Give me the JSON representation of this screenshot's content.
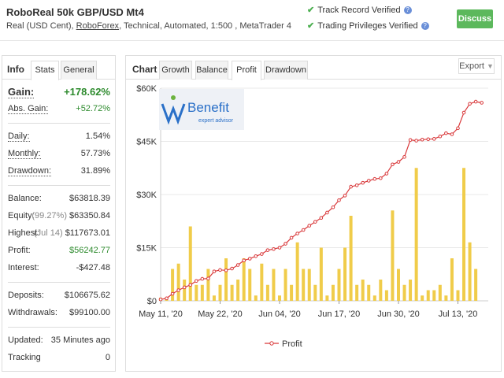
{
  "header": {
    "title": "RoboReal 50k GBP/USD Mt4",
    "subtitle_prefix": "Real (USD Cent), ",
    "broker": "RoboForex",
    "subtitle_suffix": ", Technical, Automated, 1:500 , MetaTrader 4",
    "verification": [
      {
        "label": "Track Record Verified"
      },
      {
        "label": "Trading Privileges Verified"
      }
    ],
    "discuss_label": "Discuss"
  },
  "left_panel": {
    "title": "Info",
    "tabs": [
      "Stats",
      "General"
    ],
    "active_tab": "Stats",
    "stats": [
      {
        "label": "Gain:",
        "value": "+178.62%",
        "group": 1,
        "style": "big-green"
      },
      {
        "label": "Abs. Gain:",
        "value": "+52.72%",
        "group": 1,
        "style": "green"
      },
      {
        "label": "Daily:",
        "value": "1.54%",
        "group": 2
      },
      {
        "label": "Monthly:",
        "value": "57.73%",
        "group": 2
      },
      {
        "label": "Drawdown:",
        "value": "31.89%",
        "group": 2
      },
      {
        "label": "Balance:",
        "value": "$63818.39",
        "group": 3
      },
      {
        "label": "Equity:",
        "prefix": "(99.27%)",
        "value": "$63350.84",
        "group": 3
      },
      {
        "label": "Highest:",
        "prefix": "(Jul 14)",
        "value": "$117673.01",
        "group": 3
      },
      {
        "label": "Profit:",
        "value": "$56242.77",
        "group": 3,
        "style": "green"
      },
      {
        "label": "Interest:",
        "value": "-$427.48",
        "group": 3
      },
      {
        "label": "Deposits:",
        "value": "$106675.62",
        "group": 4
      },
      {
        "label": "Withdrawals:",
        "value": "$99100.00",
        "group": 4
      },
      {
        "label": "Updated:",
        "value": "35 Minutes ago",
        "group": 5
      },
      {
        "label": "Tracking",
        "value": "0",
        "group": 5
      }
    ]
  },
  "right_panel": {
    "title": "Chart",
    "tabs": [
      "Growth",
      "Balance",
      "Profit",
      "Drawdown"
    ],
    "active_tab": "Profit",
    "export_label": "Export",
    "watermark": {
      "brand": "Benefit",
      "tagline": "expert advisor"
    }
  },
  "colors": {
    "line": "#d9393b",
    "bars": "#f0cc4a",
    "green": "#2e8b2e",
    "discuss": "#5cb85c"
  },
  "chart_data": {
    "type": "line",
    "legend": "Profit",
    "legend_position": "bottom",
    "y_ticks": [
      "$0",
      "$15K",
      "$30K",
      "$45K",
      "$60K"
    ],
    "ylim": [
      0,
      60000
    ],
    "x_ticks": [
      "May 11, '20",
      "May 22, '20",
      "Jun 04, '20",
      "Jun 17, '20",
      "Jun 30, '20",
      "Jul 13, '20"
    ],
    "x_tick_index": [
      0,
      10,
      20,
      30,
      40,
      50
    ],
    "n_points": 55,
    "series": [
      {
        "name": "Profit",
        "values": [
          400,
          700,
          2000,
          3000,
          3800,
          4500,
          5600,
          6200,
          6300,
          8300,
          8700,
          8600,
          9100,
          10100,
          11400,
          11900,
          12600,
          13200,
          14300,
          14600,
          15000,
          16100,
          17800,
          19000,
          20000,
          21200,
          22300,
          23400,
          24900,
          26400,
          28400,
          29700,
          32200,
          32600,
          33300,
          33900,
          34400,
          34600,
          35900,
          38500,
          39200,
          40600,
          45400,
          45200,
          45500,
          45600,
          45700,
          46400,
          47300,
          47000,
          48700,
          53100,
          55600,
          56200,
          55900
        ]
      },
      {
        "name": "Volume",
        "values": [
          0.3,
          0.3,
          3,
          3.5,
          2,
          7,
          1.5,
          1.5,
          3,
          0.5,
          1.5,
          4,
          1.5,
          2,
          4,
          3,
          0.5,
          3.5,
          1.5,
          3,
          0.5,
          3,
          1.5,
          5.5,
          3,
          3,
          1.5,
          5,
          0.5,
          1.5,
          3,
          5,
          8,
          1.5,
          2,
          1.5,
          0.5,
          2,
          1,
          8.5,
          3,
          1.5,
          2,
          12.5,
          0.5,
          1,
          1,
          1.5,
          0.5,
          4,
          1,
          12.5,
          5.5,
          3
        ]
      }
    ]
  }
}
